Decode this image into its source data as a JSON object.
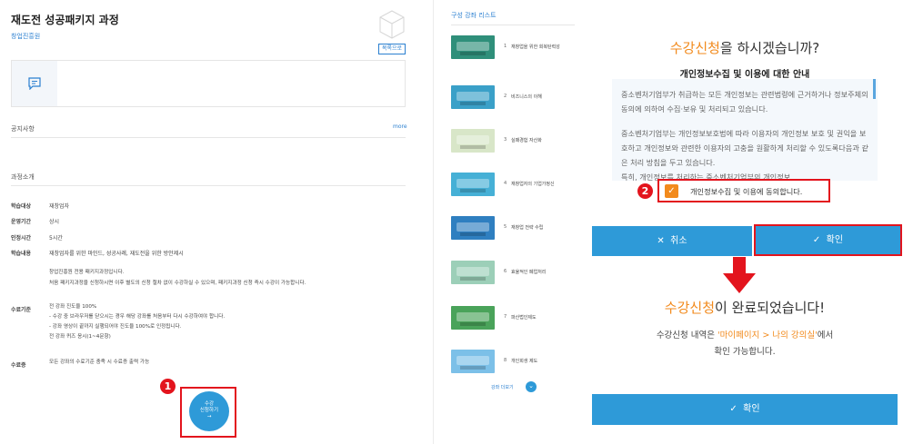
{
  "left": {
    "title": "재도전 성공패키지 과정",
    "org": "창업진흥원",
    "list_button": "목록으로",
    "notice_label": "공지사항",
    "more_label": "more",
    "intro_label": "과정소개",
    "rows": [
      {
        "label": "학습대상",
        "value": "재창업자"
      },
      {
        "label": "운영기간",
        "value": "상시"
      },
      {
        "label": "인정시간",
        "value": "5시간"
      },
      {
        "label": "학습내용",
        "value": "재창업자를 위한 마인드, 성공사례, 재도전을 위한 방안제시"
      }
    ],
    "desc1": "창업진흥원 전용 패키지과정입니다.",
    "desc2": "처음 패키지과정을 신청하시면 이후 별도의 신청 절차 없이 수강하실 수 있으며, 패키지과정 신청 즉시 수강이 가능합니다.",
    "completion_label": "수료기준",
    "completion_lines": [
      "전 강좌 진도율 100%",
      "- 수강 중 브라우저를 닫으시는 경우 해당 강좌를 처음부터 다시 수강하여야 합니다.",
      "- 강좌 영상이 끝까지 실행되어야 진도율 100%로 인정됩니다.",
      "전 강좌 퀴즈 응시(1~4문항)"
    ],
    "cert_label": "수료증",
    "cert_value": "모든 강좌의 수료기준 충족 시 수료증 출력 가능",
    "apply_line1": "수강",
    "apply_line2": "신청하기",
    "apply_arrow": "→",
    "badge1": "1"
  },
  "middle": {
    "title": "구성 강좌 리스트",
    "items": [
      {
        "num": "1",
        "text": "재창업을 위한 회복탄력성",
        "color": "#2f8f7a"
      },
      {
        "num": "2",
        "text": "비즈니스의 이해",
        "color": "#3aa0c8"
      },
      {
        "num": "3",
        "text": "실패경험 자산화",
        "color": "#d8e6c8"
      },
      {
        "num": "4",
        "text": "재창업자의 기업가정신",
        "color": "#46b0d6"
      },
      {
        "num": "5",
        "text": "재창업 전략 수립",
        "color": "#2f7fc0"
      },
      {
        "num": "6",
        "text": "효율적인 폐업처리",
        "color": "#9ccfb8"
      },
      {
        "num": "7",
        "text": "파산법인제도",
        "color": "#4aa35a"
      },
      {
        "num": "8",
        "text": "개인회생 제도",
        "color": "#7cc0e8"
      }
    ],
    "more_courses": "강좌 더보기",
    "chevron": "⌄"
  },
  "right": {
    "q_orange": "수강신청",
    "q_rest": "을 하시겠습니까?",
    "privacy_heading": "개인정보수집 및 이용에 대한 안내",
    "privacy_p1": "중소벤처기업부가 취급하는 모든 개인정보는 관련법령에 근거하거나 정보주체의 동의에 의하여 수집·보유 및 처리되고 있습니다.",
    "privacy_p2": "중소벤처기업부는 개인정보보호법에 따라 이용자의 개인정보 보호 및 권익을 보호하고 개인정보와 관련한 이용자의 고충을 원활하게 처리할 수 있도록다음과 같은 처리 방침을 두고 있습니다.",
    "privacy_p3": "특히, 개인정보를 처리하는 중소벤처기업부의 개인정보",
    "consent_text": "개인정보수집 및 이용에 동의합니다.",
    "badge2": "2",
    "cancel_label": "취소",
    "ok_label": "확인",
    "done_orange": "수강신청",
    "done_rest": "이 완료되었습니다!",
    "done_text_1": "수강신청 내역은 ",
    "done_link": "'마이페이지 > 나의 강의실'",
    "done_text_2": "에서",
    "done_text_3": "확인 가능합니다.",
    "final_ok_label": "확인"
  },
  "colors": {
    "accent": "#2e9ad8",
    "orange": "#f28a1c",
    "highlight": "#e3141d"
  }
}
